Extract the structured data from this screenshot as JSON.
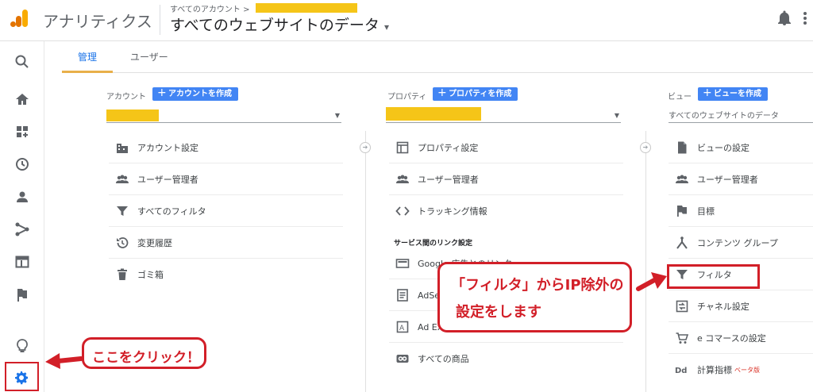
{
  "app": {
    "title": "アナリティクス",
    "breadcrumb": "すべてのアカウント >",
    "account_title": "すべてのウェブサイトのデータ",
    "account_caret": "▾"
  },
  "tabs": [
    {
      "label": "管理"
    },
    {
      "label": "ユーザー"
    }
  ],
  "columns": {
    "account": {
      "label": "アカウント",
      "create_label": "アカウントを作成",
      "items": [
        {
          "label": "アカウント設定"
        },
        {
          "label": "ユーザー管理者"
        },
        {
          "label": "すべてのフィルタ"
        },
        {
          "label": "変更履歴"
        },
        {
          "label": "ゴミ箱"
        }
      ]
    },
    "property": {
      "label": "プロパティ",
      "create_label": "プロパティを作成",
      "items": [
        {
          "label": "プロパティ設定"
        },
        {
          "label": "ユーザー管理者"
        },
        {
          "label": "トラッキング情報"
        }
      ],
      "section": "サービス間のリンク設定",
      "link_items": [
        {
          "label": "Google 広告とのリンク"
        },
        {
          "label": "AdSense のリンク設定"
        },
        {
          "label": "Ad Exchange のリンク設定"
        },
        {
          "label": "すべての商品"
        }
      ]
    },
    "view": {
      "label": "ビュー",
      "create_label": "ビューを作成",
      "selected": "すべてのウェブサイトのデータ",
      "items": [
        {
          "label": "ビューの設定"
        },
        {
          "label": "ユーザー管理者"
        },
        {
          "label": "目標"
        },
        {
          "label": "コンテンツ グループ"
        },
        {
          "label": "フィルタ"
        },
        {
          "label": "チャネル設定"
        },
        {
          "label": "e コマースの設定"
        },
        {
          "label": "計算指標",
          "badge": "ベータ版"
        }
      ]
    }
  },
  "callouts": {
    "filter_note_line1": "「フィルタ」からIP除外の",
    "filter_note_line2": "設定をします",
    "click_here": "ここをクリック！"
  },
  "colors": {
    "accent_blue": "#4285f4",
    "annotation_red": "#d21f28",
    "redaction_yellow": "#f5c518",
    "logo_orange": "#f9ab00"
  }
}
